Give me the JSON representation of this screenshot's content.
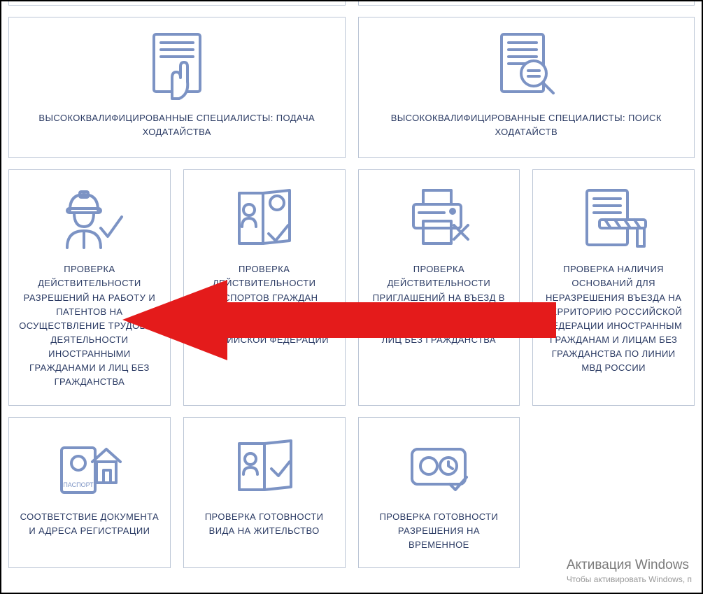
{
  "row_wide": {
    "left": "ВЫСОКОКВАЛИФИЦИРОВАННЫЕ СПЕЦИАЛИСТЫ: ПОДАЧА ХОДАТАЙСТВА",
    "right": "ВЫСОКОКВАЛИФИЦИРОВАННЫЕ СПЕЦИАЛИСТЫ: ПОИСК ХОДАТАЙСТВ"
  },
  "row4": {
    "c1": "ПРОВЕРКА ДЕЙСТВИТЕЛЬНОСТИ РАЗРЕШЕНИЙ НА РАБОТУ И ПАТЕНТОВ НА ОСУЩЕСТВЛЕНИЕ ТРУДОВОЙ ДЕЯТЕЛЬНОСТИ ИНОСТРАННЫМИ ГРАЖДАНАМИ И ЛИЦ БЕЗ ГРАЖДАНСТВА",
    "c2": "ПРОВЕРКА ДЕЙСТВИТЕЛЬНОСТИ ПАСПОРТОВ ГРАЖДАН РОССИЙСКОЙ ФЕДЕРАЦИИ ЗА ПРЕДЕЛАМИ ТЕРРИТОРИИ РОССИЙСКОЙ ФЕДЕРАЦИИ",
    "c3": "ПРОВЕРКА ДЕЙСТВИТЕЛЬНОСТИ ПРИГЛАШЕНИЙ НА ВЪЕЗД В РОССИЙСКУЮ ФЕДЕРАЦИЮ ИНОСТРАННЫХ ГРАЖДАН И ЛИЦ БЕЗ ГРАЖДАНСТВА",
    "c4": "ПРОВЕРКА НАЛИЧИЯ ОСНОВАНИЙ ДЛЯ НЕРАЗРЕШЕНИЯ ВЪЕЗДА НА ТЕРРИТОРИЮ РОССИЙСКОЙ ФЕДЕРАЦИИ ИНОСТРАННЫМ ГРАЖДАНАМ И ЛИЦАМ БЕЗ ГРАЖДАНСТВА ПО ЛИНИИ МВД РОССИИ"
  },
  "row3": {
    "c1": "СООТВЕТСТВИЕ ДОКУМЕНТА И АДРЕСА РЕГИСТРАЦИИ",
    "c2": "ПРОВЕРКА ГОТОВНОСТИ ВИДА НА ЖИТЕЛЬСТВО",
    "c3": "ПРОВЕРКА ГОТОВНОСТИ РАЗРЕШЕНИЯ НА ВРЕМЕННОЕ"
  },
  "watermark": {
    "title": "Активация Windows",
    "sub": "Чтобы активировать Windows, п"
  },
  "passport_label": "ПАСПОРТ",
  "colors": {
    "icon": "#7c93c4",
    "border": "#bcc6d6",
    "text": "#2a3a63",
    "arrow": "#e41b1b"
  }
}
